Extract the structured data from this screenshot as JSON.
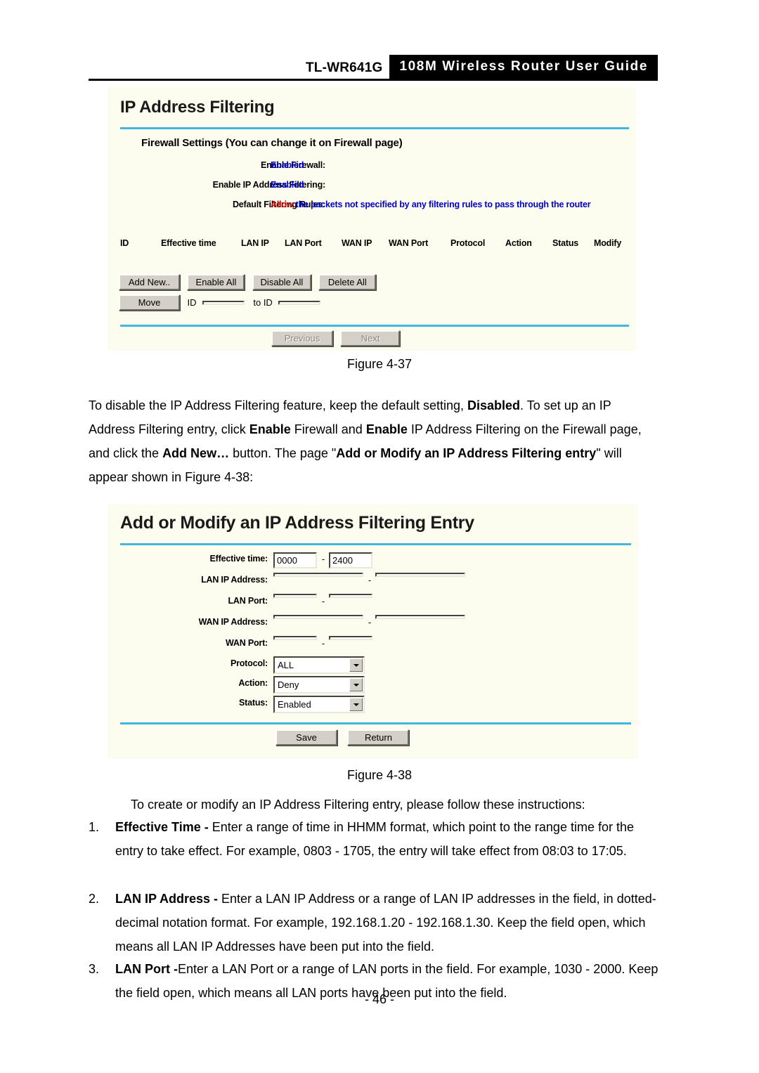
{
  "header": {
    "model": "TL-WR641G",
    "title": "108M Wireless Router User Guide"
  },
  "figure1": {
    "panel_title": "IP Address Filtering",
    "section_heading": "Firewall Settings (You can change it on Firewall page)",
    "settings": [
      {
        "label": "Enable Firewall:",
        "value": "Enabled"
      },
      {
        "label": "Enable IP Address Filtering:",
        "value": "Enabled"
      }
    ],
    "default_rule": {
      "label": "Default Filtering Rules:",
      "emphasis": "Allow",
      "rest": "the packets not specified by any filtering rules to pass through the router"
    },
    "table_headers": [
      "ID",
      "Effective time",
      "LAN IP",
      "LAN Port",
      "WAN IP",
      "WAN Port",
      "Protocol",
      "Action",
      "Status",
      "Modify"
    ],
    "buttons": [
      "Add New..",
      "Enable All",
      "Disable All",
      "Delete All"
    ],
    "move": {
      "button": "Move",
      "id_label": "ID",
      "id_value": "",
      "to_id_label": "to ID",
      "to_id_value": ""
    },
    "pager": {
      "previous": "Previous",
      "next": "Next"
    },
    "caption": "Figure 4-37"
  },
  "paragraph1": {
    "part1": "To disable the IP Address Filtering feature, keep the default setting, ",
    "b1": "Disabled",
    "part2": ". To set up an IP Address Filtering entry, click ",
    "b2": "Enable",
    "part3": " Firewall and ",
    "b3": "Enable",
    "part4": " IP Address Filtering on the Firewall page, and click the ",
    "b4": "Add New…",
    "part5": " button. The page \"",
    "b5": "Add or Modify an IP Address Filtering entry",
    "part6": "\" will appear shown in Figure 4-38:"
  },
  "figure2": {
    "panel_title": "Add or Modify an IP Address Filtering Entry",
    "fields": [
      {
        "label": "Effective time:",
        "type": "range-small",
        "value1": "0000",
        "value2": "2400",
        "sep": "-"
      },
      {
        "label": "LAN IP Address:",
        "type": "range-wide",
        "value1": "",
        "value2": "",
        "sep": "-"
      },
      {
        "label": "LAN Port:",
        "type": "range-small",
        "value1": "",
        "value2": "",
        "sep": "-"
      },
      {
        "label": "WAN IP Address:",
        "type": "range-wide",
        "value1": "",
        "value2": "",
        "sep": "-"
      },
      {
        "label": "WAN Port:",
        "type": "range-small",
        "value1": "",
        "value2": "",
        "sep": "-"
      },
      {
        "label": "Protocol:",
        "type": "select",
        "value": "ALL"
      },
      {
        "label": "Action:",
        "type": "select",
        "value": "Deny"
      },
      {
        "label": "Status:",
        "type": "select",
        "value": "Enabled"
      }
    ],
    "buttons": {
      "save": "Save",
      "return": "Return"
    },
    "caption": "Figure 4-38"
  },
  "instructions": {
    "intro": "To create or modify an IP Address Filtering entry, please follow these instructions:",
    "items": [
      {
        "num": "1.",
        "term": "Effective Time - ",
        "text": "Enter a range of time in HHMM format, which point to the range time for the entry to take effect. For example, 0803 - 1705, the entry will take effect from 08:03 to 17:05."
      },
      {
        "num": "2.",
        "term": "LAN IP Address - ",
        "text": "Enter a LAN IP Address or a range of LAN IP addresses in the field, in dotted-decimal notation format. For example, 192.168.1.20 - 192.168.1.30. Keep the field open, which means all LAN IP Addresses have been put into the field."
      },
      {
        "num": "3.",
        "term": "LAN Port -",
        "text": "Enter a LAN Port or a range of LAN ports in the field. For example, 1030 - 2000. Keep the field open, which means all LAN ports have been put into the field."
      }
    ]
  },
  "footer": {
    "page_number": "- 46 -"
  }
}
